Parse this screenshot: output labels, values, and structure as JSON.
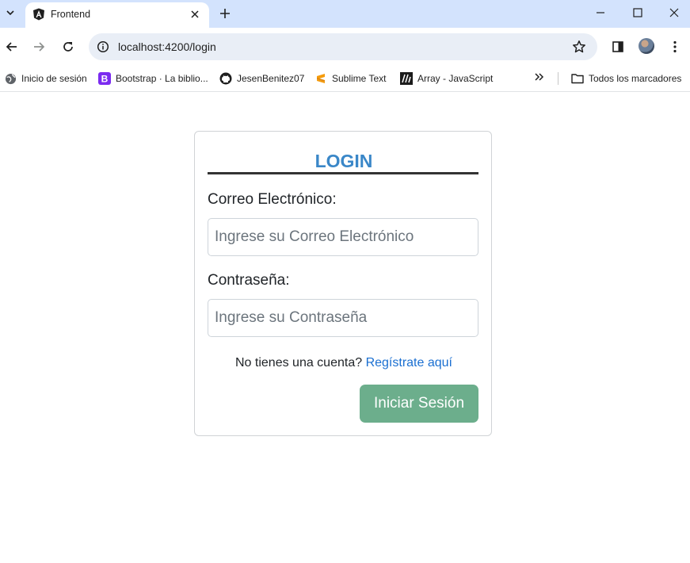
{
  "browser": {
    "tab": {
      "title": "Frontend",
      "favicon": "angular-logo"
    },
    "address": {
      "url": "localhost:4200/login"
    },
    "bookmarks": [
      {
        "label": "Inicio de sesión",
        "icon": "globe-icon"
      },
      {
        "label": "Bootstrap · La biblio...",
        "icon": "bootstrap-icon"
      },
      {
        "label": "JesenBenitez07",
        "icon": "github-icon"
      },
      {
        "label": "Sublime Text",
        "icon": "sublime-icon"
      },
      {
        "label": "Array - JavaScript",
        "icon": "mdn-icon"
      }
    ],
    "all_bookmarks": "Todos los marcadores"
  },
  "login": {
    "title": "LOGIN",
    "email_label": "Correo Electrónico:",
    "email_placeholder": "Ingrese su Correo Electrónico",
    "password_label": "Contraseña:",
    "password_placeholder": "Ingrese su Contraseña",
    "register_prompt": "No tienes una cuenta?",
    "register_link": "Regístrate aquí",
    "submit_label": "Iniciar Sesión"
  },
  "colors": {
    "tabstrip": "#d3e3fd",
    "title": "#3a87c8",
    "button": "#6cae8c",
    "link": "#1a6fd1"
  }
}
